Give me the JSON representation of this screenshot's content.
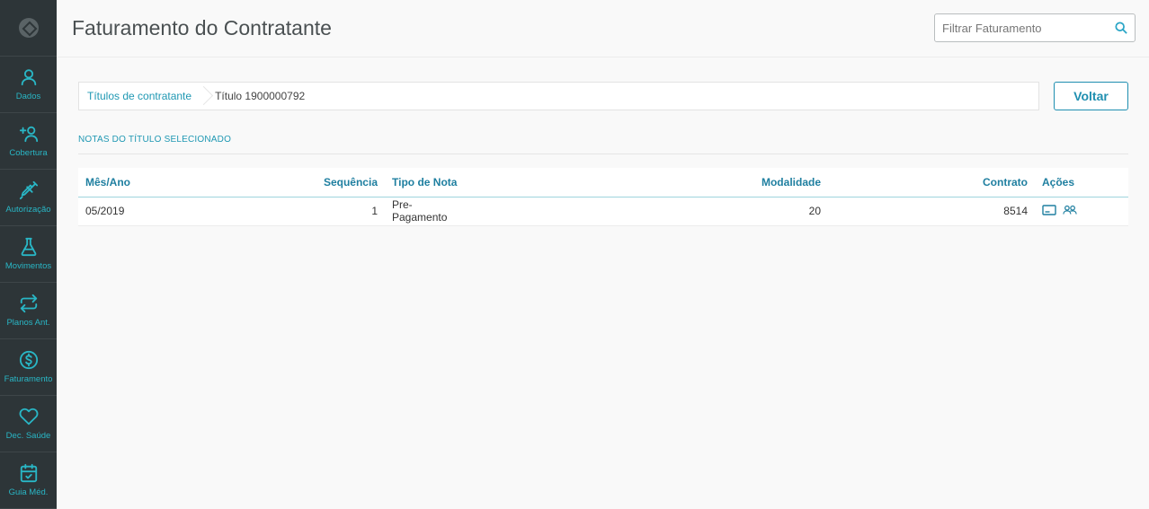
{
  "sidebar": {
    "items": [
      {
        "label": "Dados",
        "icon": "user-icon"
      },
      {
        "label": "Cobertura",
        "icon": "add-user-icon"
      },
      {
        "label": "Autorização",
        "icon": "syringe-icon"
      },
      {
        "label": "Movimentos",
        "icon": "flask-icon"
      },
      {
        "label": "Planos Ant.",
        "icon": "swap-arrows-icon"
      },
      {
        "label": "Faturamento",
        "icon": "dollar-icon"
      },
      {
        "label": "Dec. Saúde",
        "icon": "heart-icon"
      },
      {
        "label": "Guia Méd.",
        "icon": "calendar-check-icon"
      }
    ]
  },
  "header": {
    "title": "Faturamento do Contratante",
    "search_placeholder": "Filtrar Faturamento"
  },
  "breadcrumb": {
    "parent": "Títulos de contratante",
    "current": "Título 1900000792"
  },
  "back_button": "Voltar",
  "section_title": "NOTAS DO TÍTULO SELECIONADO",
  "table": {
    "headers": [
      "Mês/Ano",
      "Sequência",
      "Tipo de Nota",
      "Modalidade",
      "Contrato",
      "Ações"
    ],
    "rows": [
      {
        "mes_ano": "05/2019",
        "sequencia": "1",
        "tipo": "Pre-Pagamento",
        "modalidade": "20",
        "contrato": "8514",
        "actions": [
          "card-icon",
          "users-icon"
        ]
      }
    ]
  },
  "colors": {
    "sidebar_bg": "#2d3538",
    "accent": "#29b6c5",
    "link": "#1f98b3",
    "header_text": "#1f7fa0"
  }
}
